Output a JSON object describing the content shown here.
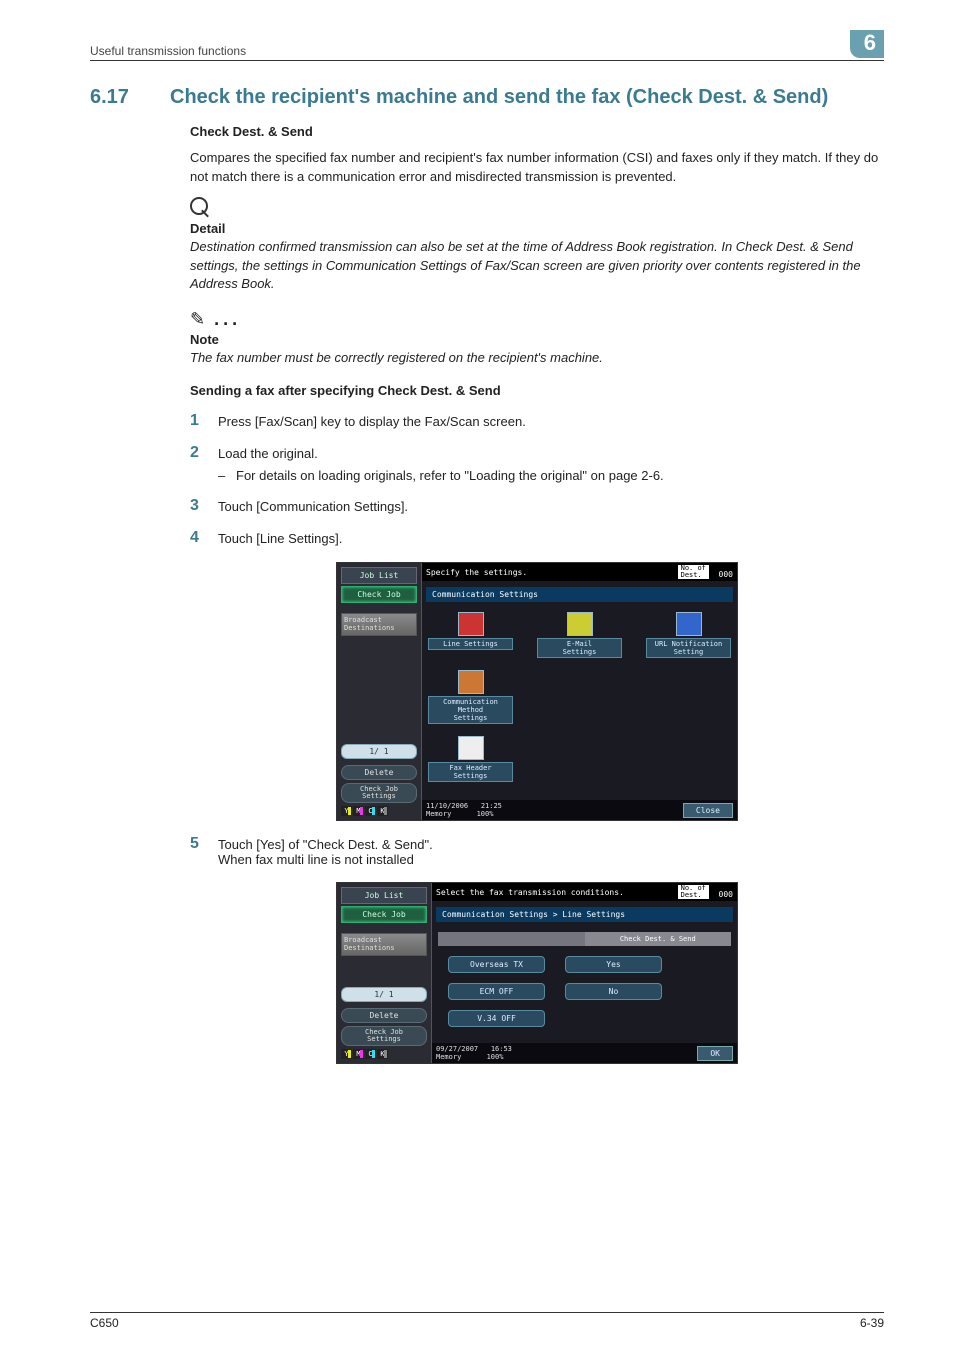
{
  "header": {
    "running_head": "Useful transmission functions",
    "chapter_number": "6"
  },
  "section": {
    "number": "6.17",
    "title": "Check the recipient's machine and send the fax (Check Dest. & Send)"
  },
  "subsections": {
    "check_dest_title": "Check Dest. & Send",
    "intro_para": "Compares the specified fax number and recipient's fax number information (CSI) and faxes only if they match. If they do not match there is a communication error and misdirected transmission is prevented.",
    "detail_label": "Detail",
    "detail_text": "Destination confirmed transmission can also be set at the time of Address Book registration. In Check Dest. & Send settings, the settings in Communication Settings of Fax/Scan screen are given priority over contents registered in the Address Book.",
    "note_label": "Note",
    "note_text": "The fax number must be correctly registered on the recipient's machine.",
    "sending_title": "Sending a fax after specifying Check Dest. & Send"
  },
  "steps": {
    "s1": "Press [Fax/Scan] key to display the Fax/Scan screen.",
    "s2": "Load the original.",
    "s2_bullet": "For details on loading originals, refer to \"Loading the original\" on page 2-6.",
    "s3": "Touch [Communication Settings].",
    "s4": "Touch [Line Settings].",
    "s5_line1": "Touch [Yes] of \"Check Dest. & Send\".",
    "s5_line2": "When fax multi line is not installed"
  },
  "screen1": {
    "sidebar": {
      "job_list": "Job List",
      "check_job": "Check Job",
      "broadcast": "Broadcast\nDestinations",
      "counter": "1/  1",
      "delete": "Delete",
      "check_settings": "Check Job\nSettings"
    },
    "topbar": {
      "prompt": "Specify the settings.",
      "dest_label": "No. of\nDest.",
      "dest_count": "000"
    },
    "header_bar": "Communication Settings",
    "buttons": {
      "line_settings": "Line Settings",
      "email_settings": "E-Mail\nSettings",
      "url_notification": "URL Notification\nSetting",
      "comm_method": "Communication Method\nSettings",
      "fax_header": "Fax Header\nSettings"
    },
    "footer": {
      "date": "11/10/2006",
      "time": "21:25",
      "memory_label": "Memory",
      "memory_value": "100%",
      "close": "Close"
    },
    "ymck": {
      "y": "Y",
      "m": "M",
      "c": "C",
      "k": "K"
    }
  },
  "screen2": {
    "sidebar": {
      "job_list": "Job List",
      "check_job": "Check Job",
      "broadcast": "Broadcast\nDestinations",
      "counter": "1/  1",
      "delete": "Delete",
      "check_settings": "Check Job\nSettings"
    },
    "topbar": {
      "prompt": "Select the fax transmission conditions.",
      "dest_label": "No. of\nDest.",
      "dest_count": "000"
    },
    "header_bar": "Communication Settings > Line Settings",
    "column_head": "Check Dest. & Send",
    "pills": {
      "overseas": "Overseas TX",
      "yes": "Yes",
      "ecm": "ECM OFF",
      "no": "No",
      "v34": "V.34 OFF"
    },
    "footer": {
      "date": "09/27/2007",
      "time": "16:53",
      "memory_label": "Memory",
      "memory_value": "100%",
      "ok": "OK"
    },
    "ymck": {
      "y": "Y",
      "m": "M",
      "c": "C",
      "k": "K"
    }
  },
  "footer": {
    "model": "C650",
    "page": "6-39"
  }
}
